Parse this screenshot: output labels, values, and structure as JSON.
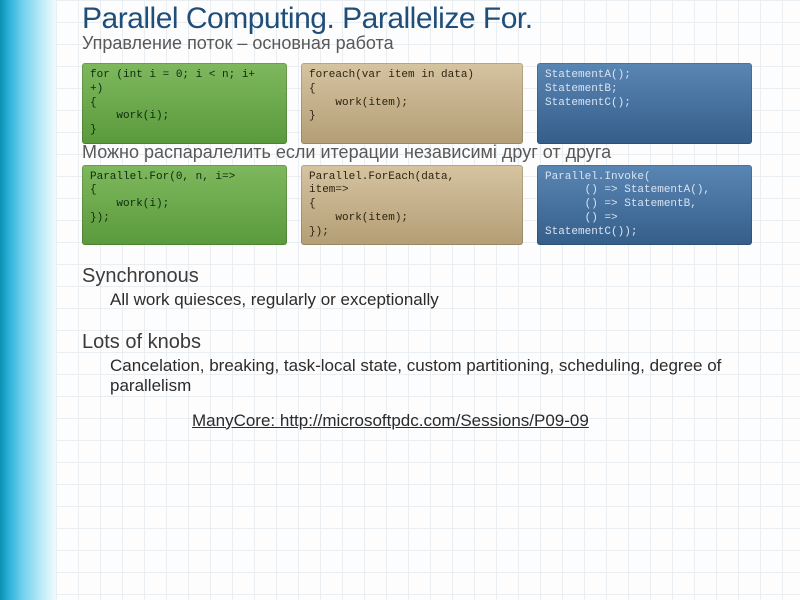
{
  "title": "Parallel Computing. Parallelize For.",
  "subtitle": "Управление поток – основная работа",
  "row1": {
    "green": "for (int i = 0; i < n; i+\n+)\n{\n    work(i);\n}",
    "tan": "foreach(var item in data)\n{\n    work(item);\n}",
    "blue": "StatementA();\nStatementB;\nStatementC();"
  },
  "midtext": "Можно распаралелить если итерации независимі друг от друга",
  "row2": {
    "green": "Parallel.For(0, n, i=>\n{\n    work(i);\n});",
    "tan": "Parallel.ForEach(data,\nitem=>\n{\n    work(item);\n});",
    "blue": "Parallel.Invoke(\n      () => StatementA(),\n      () => StatementB,\n      () =>\nStatementC());"
  },
  "sync": {
    "heading": "Synchronous",
    "body": "All work quiesces, regularly or exceptionally"
  },
  "knobs": {
    "heading": "Lots of knobs",
    "body": "Cancelation, breaking, task-local state, custom partitioning, scheduling, degree of parallelism"
  },
  "link": "ManyCore: http://microsoftpdc.com/Sessions/P09-09"
}
